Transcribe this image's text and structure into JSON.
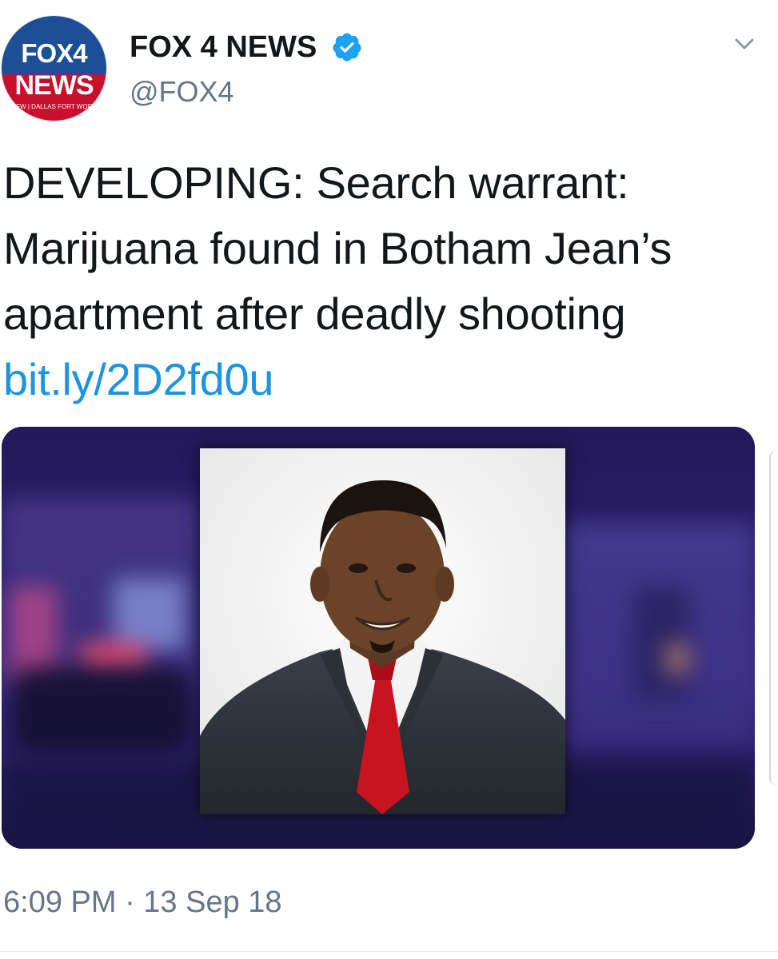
{
  "author": {
    "display_name": "FOX 4 NEWS",
    "handle": "@FOX4",
    "verified": true,
    "avatar": {
      "line1": "FOX4",
      "line2": "NEWS",
      "line3": "KDFW | DALLAS FORT WORTH"
    }
  },
  "tweet": {
    "text_lines": [
      "DEVELOPING: Search warrant:",
      "Marijuana found in Botham Jean’s",
      "apartment after deadly shooting"
    ],
    "link": "bit.ly/2D2fd0u",
    "timestamp": "6:09 PM · 13 Sep 18"
  },
  "icons": {
    "verified": "verified-badge-icon",
    "menu": "chevron-down-icon"
  },
  "colors": {
    "link": "#1b95e0",
    "verified": "#1da1f2",
    "secondary_text": "#657786",
    "primary_text": "#14171a"
  }
}
